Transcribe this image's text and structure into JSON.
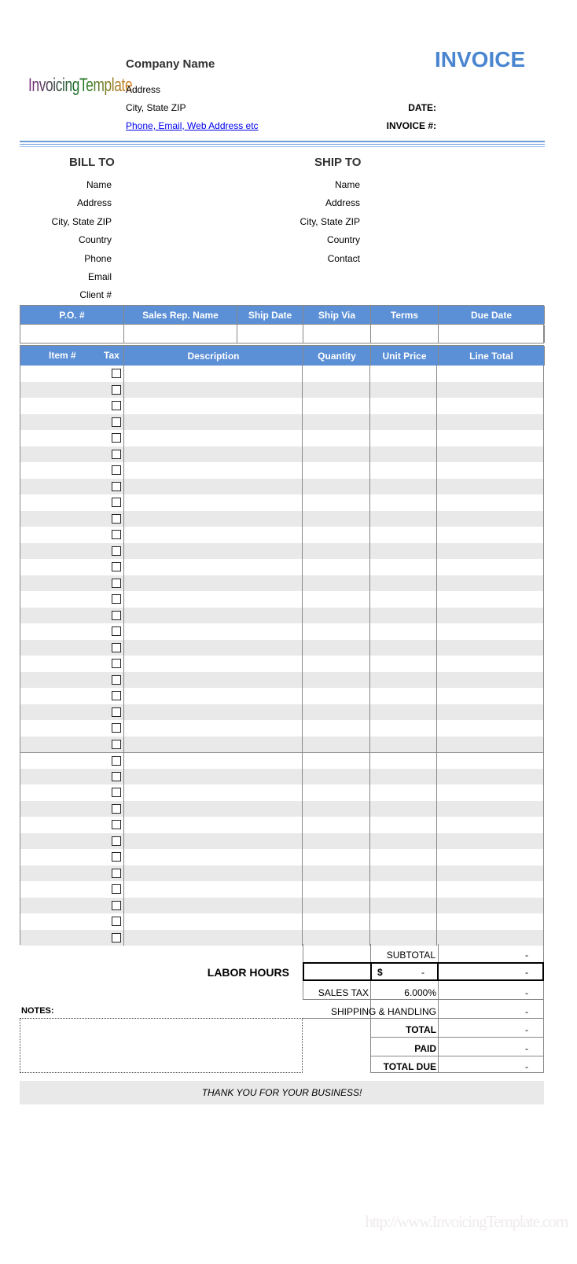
{
  "logo": "InvoicingTemplate",
  "company": {
    "name": "Company Name",
    "address": "Address",
    "city": "City, State ZIP",
    "contact": "Phone, Email, Web Address etc"
  },
  "title": "INVOICE",
  "meta": {
    "date_label": "DATE:",
    "invoice_label": "INVOICE #:"
  },
  "bill_to": {
    "title": "BILL TO",
    "fields": [
      "Name",
      "Address",
      "City, State ZIP",
      "Country",
      "Phone",
      "Email",
      "Client #"
    ]
  },
  "ship_to": {
    "title": "SHIP TO",
    "fields": [
      "Name",
      "Address",
      "City, State ZIP",
      "Country",
      "Contact"
    ]
  },
  "order_table": {
    "headers": [
      "P.O. #",
      "Sales Rep. Name",
      "Ship Date",
      "Ship Via",
      "Terms",
      "Due Date"
    ]
  },
  "items_table": {
    "headers": [
      "Item #",
      "Tax",
      "Description",
      "Quantity",
      "Unit Price",
      "Line Total"
    ],
    "row_count": 36,
    "tax_checked": false
  },
  "totals": {
    "subtotal_label": "SUBTOTAL",
    "subtotal": "-",
    "labor_label": "LABOR HOURS",
    "labor_currency": "$",
    "labor_rate": "-",
    "labor_total": "-",
    "sales_tax_label": "SALES TAX",
    "sales_tax_rate": "6.000%",
    "sales_tax": "-",
    "shipping_label": "SHIPPING & HANDLING",
    "shipping": "-",
    "total_label": "TOTAL",
    "total": "-",
    "paid_label": "PAID",
    "paid": "-",
    "total_due_label": "TOTAL DUE",
    "total_due": "-"
  },
  "notes_label": "NOTES:",
  "footer": "THANK YOU FOR YOUR BUSINESS!",
  "watermark": "http://www.InvoicingTemplate.com",
  "colors": {
    "accent": "#5b8fd6",
    "title": "#4a86d0",
    "row_alt": "#e9e9e9"
  }
}
